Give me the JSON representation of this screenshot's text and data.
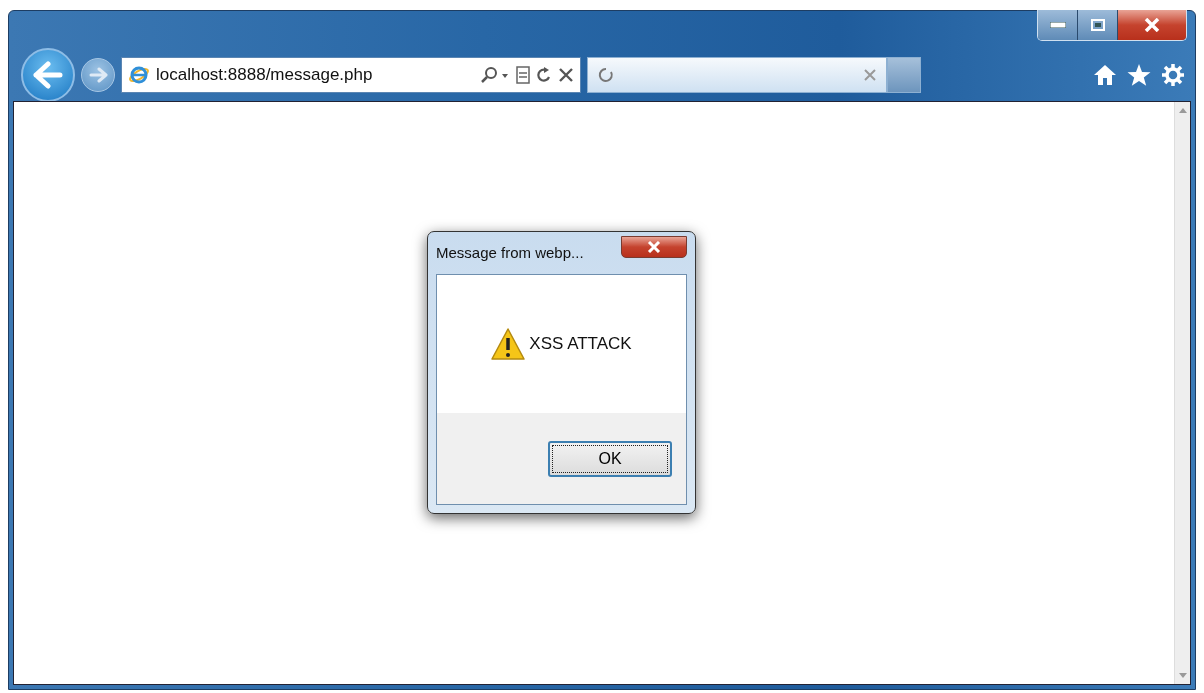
{
  "window": {
    "buttons": [
      {
        "kind": "minimize"
      },
      {
        "kind": "maximize"
      },
      {
        "kind": "close"
      }
    ]
  },
  "address_bar": {
    "url": "localhost:8888/message.php"
  },
  "tab": {
    "loading": true
  },
  "dialog": {
    "title": "Message from webp...",
    "message": "XSS ATTACK",
    "buttons": [
      {
        "label": "OK",
        "focused": true
      }
    ]
  }
}
